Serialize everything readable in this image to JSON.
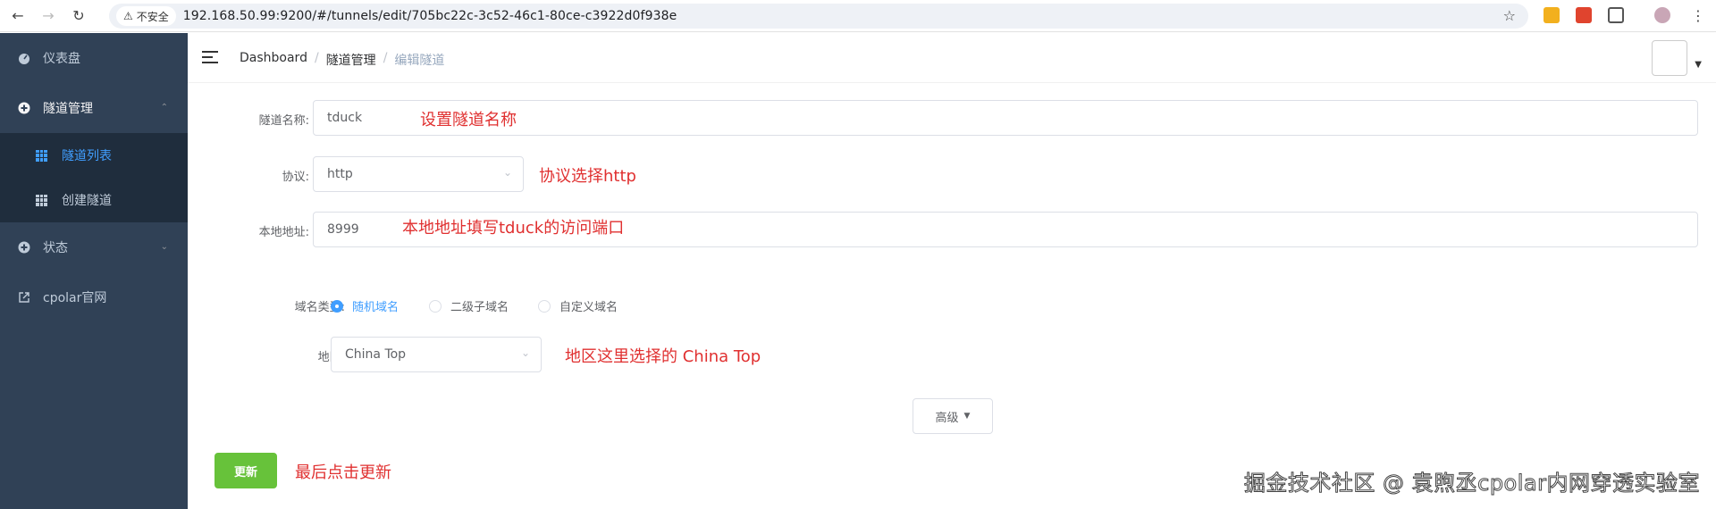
{
  "browser": {
    "security_label": "不安全",
    "url": "192.168.50.99:9200/#/tunnels/edit/705bc22c-3c52-46c1-80ce-c3922d0f938e"
  },
  "sidebar": {
    "items": [
      {
        "label": "仪表盘",
        "icon": "dashboard-icon"
      },
      {
        "label": "隧道管理",
        "icon": "plus-circle-icon"
      },
      {
        "label": "状态",
        "icon": "plus-circle-icon"
      },
      {
        "label": "cpolar官网",
        "icon": "external-link-icon"
      }
    ],
    "sub_items": [
      {
        "label": "隧道列表",
        "icon": "grid-icon"
      },
      {
        "label": "创建隧道",
        "icon": "grid-icon"
      }
    ]
  },
  "breadcrumb": {
    "items": [
      "Dashboard",
      "隧道管理",
      "编辑隧道"
    ],
    "separator": "/"
  },
  "form": {
    "name_label": "隧道名称:",
    "name_value": "tduck",
    "name_note": "设置隧道名称",
    "protocol_label": "协议:",
    "protocol_value": "http",
    "protocol_note": "协议选择http",
    "addr_label": "本地地址:",
    "addr_value": "8999",
    "addr_note": "本地地址填写tduck的访问端口",
    "domain_type_label": "域名类型:",
    "domain_options": [
      "随机域名",
      "二级子域名",
      "自定义域名"
    ],
    "region_label": "地区:",
    "region_value": "China Top",
    "region_note": "地区这里选择的 China Top",
    "advanced_label": "高级",
    "update_label": "更新",
    "update_note": "最后点击更新"
  },
  "watermark": "掘金技术社区 @ 袁煦丞cpolar内网穿透实验室",
  "colors": {
    "sidebar_bg": "#304156",
    "submenu_bg": "#1f2d3d",
    "active_blue": "#409eff",
    "update_green": "#67c23a",
    "annotation_red": "#e03030"
  }
}
